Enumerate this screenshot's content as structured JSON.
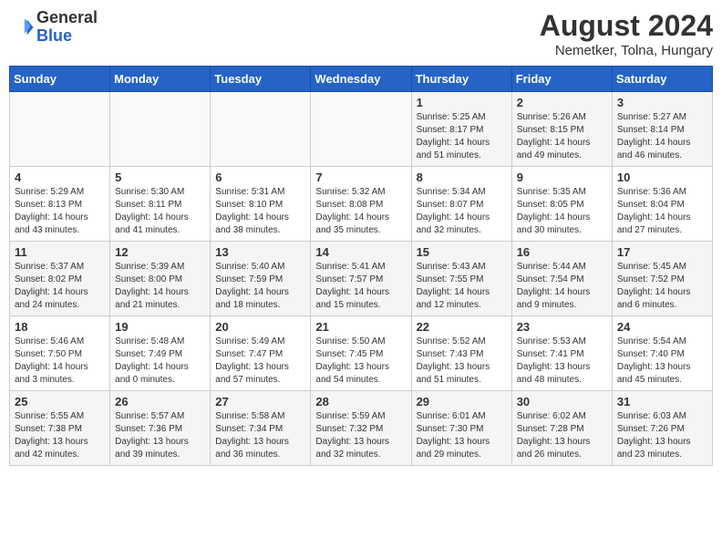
{
  "header": {
    "logo": {
      "general": "General",
      "blue": "Blue"
    },
    "title": "August 2024",
    "location": "Nemetker, Tolna, Hungary"
  },
  "weekdays": [
    "Sunday",
    "Monday",
    "Tuesday",
    "Wednesday",
    "Thursday",
    "Friday",
    "Saturday"
  ],
  "weeks": [
    [
      {
        "day": "",
        "info": ""
      },
      {
        "day": "",
        "info": ""
      },
      {
        "day": "",
        "info": ""
      },
      {
        "day": "",
        "info": ""
      },
      {
        "day": "1",
        "info": "Sunrise: 5:25 AM\nSunset: 8:17 PM\nDaylight: 14 hours\nand 51 minutes."
      },
      {
        "day": "2",
        "info": "Sunrise: 5:26 AM\nSunset: 8:15 PM\nDaylight: 14 hours\nand 49 minutes."
      },
      {
        "day": "3",
        "info": "Sunrise: 5:27 AM\nSunset: 8:14 PM\nDaylight: 14 hours\nand 46 minutes."
      }
    ],
    [
      {
        "day": "4",
        "info": "Sunrise: 5:29 AM\nSunset: 8:13 PM\nDaylight: 14 hours\nand 43 minutes."
      },
      {
        "day": "5",
        "info": "Sunrise: 5:30 AM\nSunset: 8:11 PM\nDaylight: 14 hours\nand 41 minutes."
      },
      {
        "day": "6",
        "info": "Sunrise: 5:31 AM\nSunset: 8:10 PM\nDaylight: 14 hours\nand 38 minutes."
      },
      {
        "day": "7",
        "info": "Sunrise: 5:32 AM\nSunset: 8:08 PM\nDaylight: 14 hours\nand 35 minutes."
      },
      {
        "day": "8",
        "info": "Sunrise: 5:34 AM\nSunset: 8:07 PM\nDaylight: 14 hours\nand 32 minutes."
      },
      {
        "day": "9",
        "info": "Sunrise: 5:35 AM\nSunset: 8:05 PM\nDaylight: 14 hours\nand 30 minutes."
      },
      {
        "day": "10",
        "info": "Sunrise: 5:36 AM\nSunset: 8:04 PM\nDaylight: 14 hours\nand 27 minutes."
      }
    ],
    [
      {
        "day": "11",
        "info": "Sunrise: 5:37 AM\nSunset: 8:02 PM\nDaylight: 14 hours\nand 24 minutes."
      },
      {
        "day": "12",
        "info": "Sunrise: 5:39 AM\nSunset: 8:00 PM\nDaylight: 14 hours\nand 21 minutes."
      },
      {
        "day": "13",
        "info": "Sunrise: 5:40 AM\nSunset: 7:59 PM\nDaylight: 14 hours\nand 18 minutes."
      },
      {
        "day": "14",
        "info": "Sunrise: 5:41 AM\nSunset: 7:57 PM\nDaylight: 14 hours\nand 15 minutes."
      },
      {
        "day": "15",
        "info": "Sunrise: 5:43 AM\nSunset: 7:55 PM\nDaylight: 14 hours\nand 12 minutes."
      },
      {
        "day": "16",
        "info": "Sunrise: 5:44 AM\nSunset: 7:54 PM\nDaylight: 14 hours\nand 9 minutes."
      },
      {
        "day": "17",
        "info": "Sunrise: 5:45 AM\nSunset: 7:52 PM\nDaylight: 14 hours\nand 6 minutes."
      }
    ],
    [
      {
        "day": "18",
        "info": "Sunrise: 5:46 AM\nSunset: 7:50 PM\nDaylight: 14 hours\nand 3 minutes."
      },
      {
        "day": "19",
        "info": "Sunrise: 5:48 AM\nSunset: 7:49 PM\nDaylight: 14 hours\nand 0 minutes."
      },
      {
        "day": "20",
        "info": "Sunrise: 5:49 AM\nSunset: 7:47 PM\nDaylight: 13 hours\nand 57 minutes."
      },
      {
        "day": "21",
        "info": "Sunrise: 5:50 AM\nSunset: 7:45 PM\nDaylight: 13 hours\nand 54 minutes."
      },
      {
        "day": "22",
        "info": "Sunrise: 5:52 AM\nSunset: 7:43 PM\nDaylight: 13 hours\nand 51 minutes."
      },
      {
        "day": "23",
        "info": "Sunrise: 5:53 AM\nSunset: 7:41 PM\nDaylight: 13 hours\nand 48 minutes."
      },
      {
        "day": "24",
        "info": "Sunrise: 5:54 AM\nSunset: 7:40 PM\nDaylight: 13 hours\nand 45 minutes."
      }
    ],
    [
      {
        "day": "25",
        "info": "Sunrise: 5:55 AM\nSunset: 7:38 PM\nDaylight: 13 hours\nand 42 minutes."
      },
      {
        "day": "26",
        "info": "Sunrise: 5:57 AM\nSunset: 7:36 PM\nDaylight: 13 hours\nand 39 minutes."
      },
      {
        "day": "27",
        "info": "Sunrise: 5:58 AM\nSunset: 7:34 PM\nDaylight: 13 hours\nand 36 minutes."
      },
      {
        "day": "28",
        "info": "Sunrise: 5:59 AM\nSunset: 7:32 PM\nDaylight: 13 hours\nand 32 minutes."
      },
      {
        "day": "29",
        "info": "Sunrise: 6:01 AM\nSunset: 7:30 PM\nDaylight: 13 hours\nand 29 minutes."
      },
      {
        "day": "30",
        "info": "Sunrise: 6:02 AM\nSunset: 7:28 PM\nDaylight: 13 hours\nand 26 minutes."
      },
      {
        "day": "31",
        "info": "Sunrise: 6:03 AM\nSunset: 7:26 PM\nDaylight: 13 hours\nand 23 minutes."
      }
    ]
  ]
}
